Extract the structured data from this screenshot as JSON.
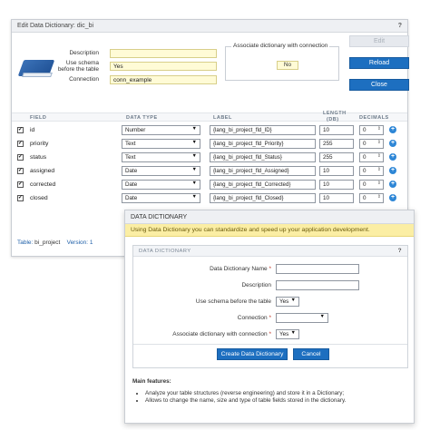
{
  "main_window": {
    "title": "Edit Data Dictionary: dic_bi",
    "help": "?",
    "description_label": "Description",
    "description_value": "",
    "schema_label_1": "Use schema",
    "schema_label_2": "before the table",
    "schema_value": "Yes",
    "connection_label": "Connection",
    "connection_value": "conn_example",
    "assoc_legend": "Associate dictionary with connection",
    "assoc_value": "No",
    "edit_label": "Edit",
    "reload_label": "Reload",
    "close_label": "Close",
    "headers": {
      "field": "FIELD",
      "data_type": "DATA TYPE",
      "label": "LABEL",
      "length_1": "LENGTH",
      "length_2": "(DB)",
      "decimals": "DECIMALS"
    },
    "fields": [
      {
        "name": "id",
        "type": "Number",
        "label": "{lang_bi_project_fld_ID}",
        "length": "10",
        "decimals": "0"
      },
      {
        "name": "priority",
        "type": "Text",
        "label": "{lang_bi_project_fld_Priority}",
        "length": "255",
        "decimals": "0"
      },
      {
        "name": "status",
        "type": "Text",
        "label": "{lang_bi_project_fld_Status}",
        "length": "255",
        "decimals": "0"
      },
      {
        "name": "assigned",
        "type": "Date",
        "label": "{lang_bi_project_fld_Assigned}",
        "length": "10",
        "decimals": "0"
      },
      {
        "name": "corrected",
        "type": "Date",
        "label": "{lang_bi_project_fld_Corrected}",
        "length": "10",
        "decimals": "0"
      },
      {
        "name": "closed",
        "type": "Date",
        "label": "{lang_bi_project_fld_Closed}",
        "length": "10",
        "decimals": "0"
      }
    ],
    "footer_table_label": "Table:",
    "footer_table_value": "bi_project",
    "footer_version_label": "Version:",
    "footer_version_value": "1"
  },
  "dialog": {
    "title": "DATA DICTIONARY",
    "notice": "Using Data Dictionary you can standardize and speed up your application development.",
    "section_title": "DATA DICTIONARY",
    "section_help": "?",
    "name_label": "Data Dictionary Name",
    "description_label": "Description",
    "schema_label": "Use schema before the table",
    "schema_value": "Yes",
    "connection_label": "Connection",
    "connection_value": "",
    "assoc_label": "Associate dictionary with connection",
    "assoc_value": "Yes",
    "required_mark": "*",
    "create_label": "Create Data Dictionary",
    "cancel_label": "Cancel",
    "features_heading": "Main features:",
    "features": [
      "Analyze your table structures (reverse engineering) and store it in a Dictionary;",
      "Allows to change the name, size and type of table fields stored in the dictionary."
    ]
  },
  "colors": {
    "primary": "#1d6fc0",
    "highlight_input": "#fffbd6",
    "notice": "#fbeea4"
  }
}
